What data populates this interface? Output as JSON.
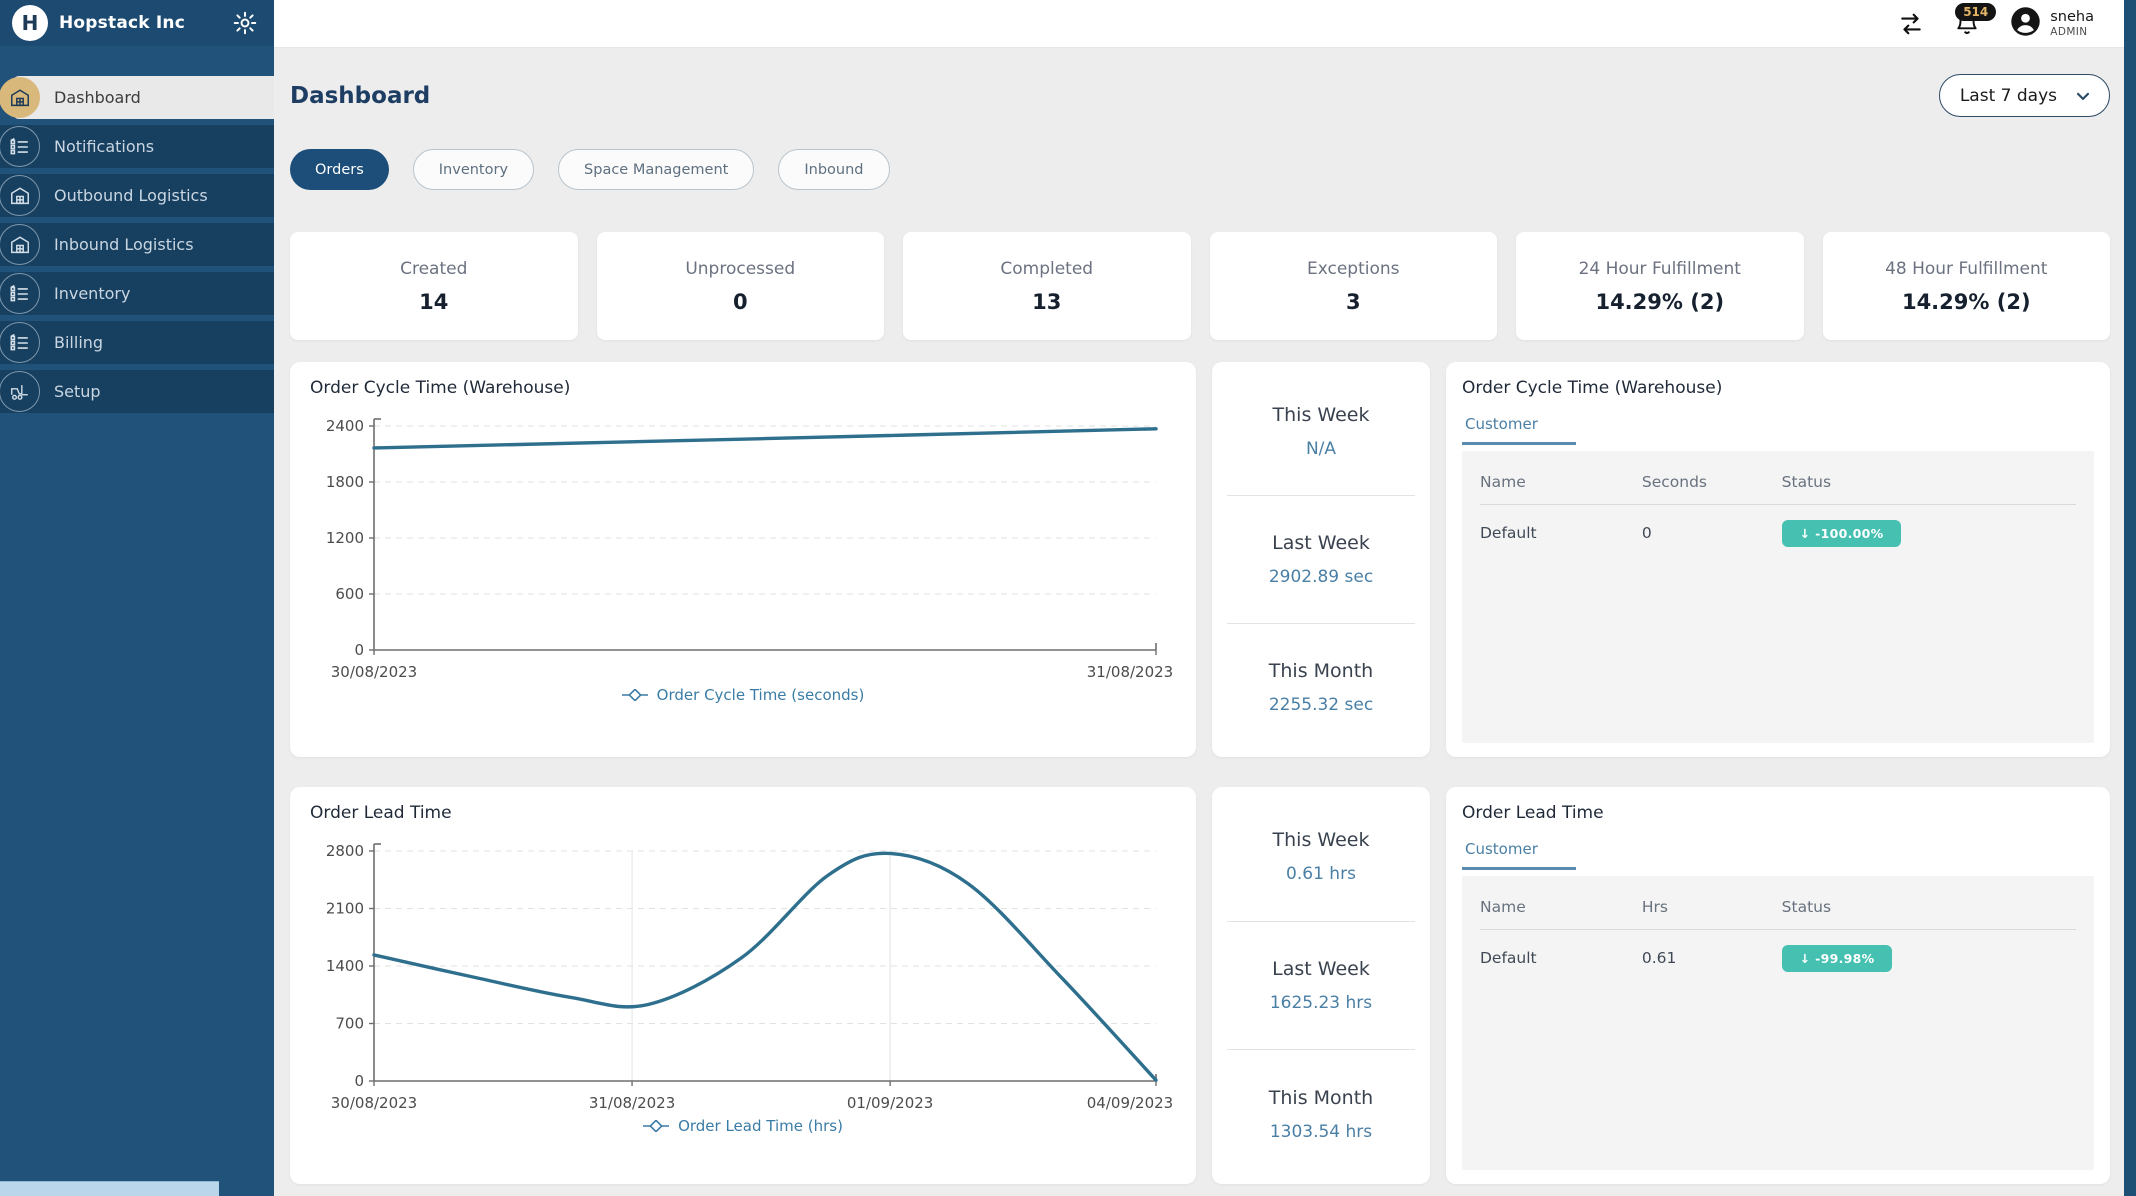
{
  "sidebar": {
    "brand": "Hopstack Inc",
    "logo_letter": "H",
    "items": [
      {
        "label": "Dashboard",
        "icon": "warehouse-icon",
        "active": true
      },
      {
        "label": "Notifications",
        "icon": "checklist-icon",
        "active": false
      },
      {
        "label": "Outbound Logistics",
        "icon": "warehouse-icon",
        "active": false
      },
      {
        "label": "Inbound Logistics",
        "icon": "warehouse-icon",
        "active": false
      },
      {
        "label": "Inventory",
        "icon": "checklist-icon",
        "active": false
      },
      {
        "label": "Billing",
        "icon": "checklist-icon",
        "active": false
      },
      {
        "label": "Setup",
        "icon": "forklift-icon",
        "active": false
      }
    ]
  },
  "topbar": {
    "notification_count": "514",
    "user_name": "sneha",
    "user_role": "ADMIN"
  },
  "page": {
    "title": "Dashboard",
    "date_filter": "Last 7 days"
  },
  "filters": [
    {
      "label": "Orders",
      "active": true
    },
    {
      "label": "Inventory",
      "active": false
    },
    {
      "label": "Space Management",
      "active": false
    },
    {
      "label": "Inbound",
      "active": false
    }
  ],
  "stats": [
    {
      "label": "Created",
      "value": "14"
    },
    {
      "label": "Unprocessed",
      "value": "0"
    },
    {
      "label": "Completed",
      "value": "13"
    },
    {
      "label": "Exceptions",
      "value": "3"
    },
    {
      "label": "24 Hour Fulfillment",
      "value": "14.29% (2)"
    },
    {
      "label": "48 Hour Fulfillment",
      "value": "14.29% (2)"
    }
  ],
  "chart_data": [
    {
      "type": "line",
      "title": "Order Cycle Time (Warehouse)",
      "legend": "Order Cycle Time (seconds)",
      "color": "#2e6f8e",
      "ylim": [
        0,
        2400
      ],
      "yticks": [
        0,
        600,
        1200,
        1800,
        2400
      ],
      "x_labels": [
        "30/08/2023",
        "31/08/2023"
      ],
      "xticks": [
        {
          "f": 0,
          "label": "30/08/2023"
        },
        {
          "f": 1,
          "label": "31/08/2023"
        }
      ],
      "xgrid": [],
      "grid": "horizontal-dashed",
      "legend_position": "bottom",
      "points": [
        [
          0,
          2165
        ],
        [
          0.5,
          2265
        ],
        [
          1,
          2370
        ]
      ]
    },
    {
      "type": "line",
      "title": "Order Lead Time",
      "legend": "Order Lead Time (hrs)",
      "color": "#2e6f8e",
      "ylim": [
        0,
        2800
      ],
      "yticks": [
        0,
        700,
        1400,
        2100,
        2800
      ],
      "x_labels": [
        "30/08/2023",
        "31/08/2023",
        "01/09/2023",
        "04/09/2023"
      ],
      "xticks": [
        {
          "f": 0,
          "label": "30/08/2023"
        },
        {
          "f": 0.33,
          "label": "31/08/2023"
        },
        {
          "f": 0.66,
          "label": "01/09/2023"
        },
        {
          "f": 1,
          "label": "04/09/2023"
        }
      ],
      "xgrid": [
        0.33,
        0.66
      ],
      "grid": "both",
      "legend_position": "bottom",
      "points": [
        [
          0,
          1535
        ],
        [
          0.12,
          1280
        ],
        [
          0.25,
          1020
        ],
        [
          0.35,
          930
        ],
        [
          0.47,
          1500
        ],
        [
          0.58,
          2500
        ],
        [
          0.66,
          2770
        ],
        [
          0.76,
          2400
        ],
        [
          0.88,
          1250
        ],
        [
          1,
          10
        ]
      ]
    }
  ],
  "panels": [
    {
      "rows": [
        {
          "label": "This Week",
          "value": "N/A"
        },
        {
          "label": "Last Week",
          "value": "2902.89 sec"
        },
        {
          "label": "This Month",
          "value": "2255.32 sec"
        }
      ]
    },
    {
      "rows": [
        {
          "label": "This Week",
          "value": "0.61 hrs"
        },
        {
          "label": "Last Week",
          "value": "1625.23 hrs"
        },
        {
          "label": "This Month",
          "value": "1303.54 hrs"
        }
      ]
    }
  ],
  "tables": [
    {
      "title": "Order Cycle Time (Warehouse)",
      "tab": "Customer",
      "columns": [
        "Name",
        "Seconds",
        "Status"
      ],
      "rows": [
        {
          "name": "Default",
          "value": "0",
          "status": "↓ -100.00%"
        }
      ],
      "status_color": "#45c0b1"
    },
    {
      "title": "Order Lead Time",
      "tab": "Customer",
      "columns": [
        "Name",
        "Hrs",
        "Status"
      ],
      "rows": [
        {
          "name": "Default",
          "value": "0.61",
          "status": "↓ -99.98%"
        }
      ],
      "status_color": "#45c0b1"
    }
  ]
}
